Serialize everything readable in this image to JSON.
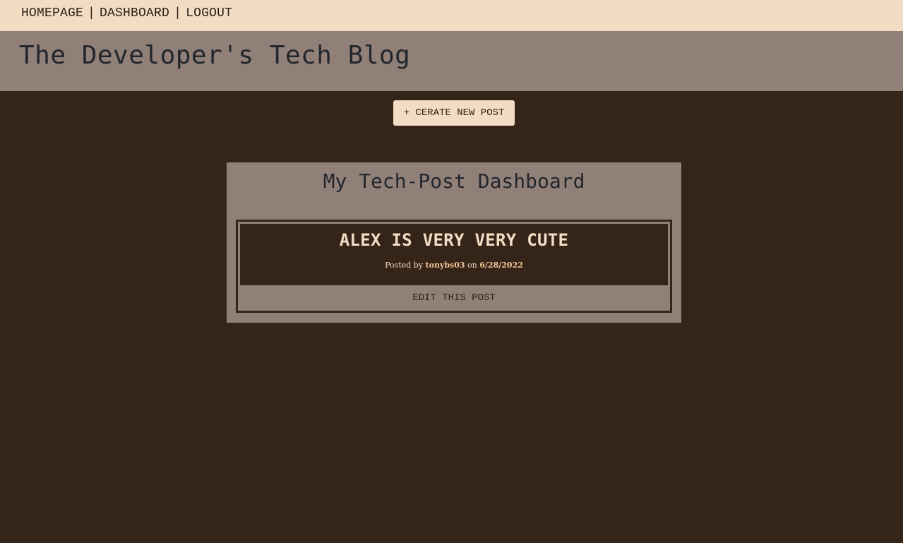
{
  "nav": {
    "items": [
      {
        "label": "HOMEPAGE"
      },
      {
        "label": "DASHBOARD"
      },
      {
        "label": "LOGOUT"
      }
    ],
    "separator": "|"
  },
  "header": {
    "title": "The Developer's Tech Blog"
  },
  "actions": {
    "new_post_label": "+ CERATE NEW POST"
  },
  "dashboard": {
    "title": "My Tech-Post Dashboard",
    "posts": [
      {
        "title": "ALEX IS VERY VERY CUTE",
        "posted_by_prefix": "Posted by",
        "author": "tonybs03",
        "on_word": "on",
        "date": "6/28/2022",
        "edit_label": "EDIT THIS POST"
      }
    ]
  },
  "colors": {
    "page_bg": "#352418",
    "nav_bg": "#f2dcc3",
    "banner_bg": "#918078",
    "accent_text": "#f2dcc3"
  }
}
